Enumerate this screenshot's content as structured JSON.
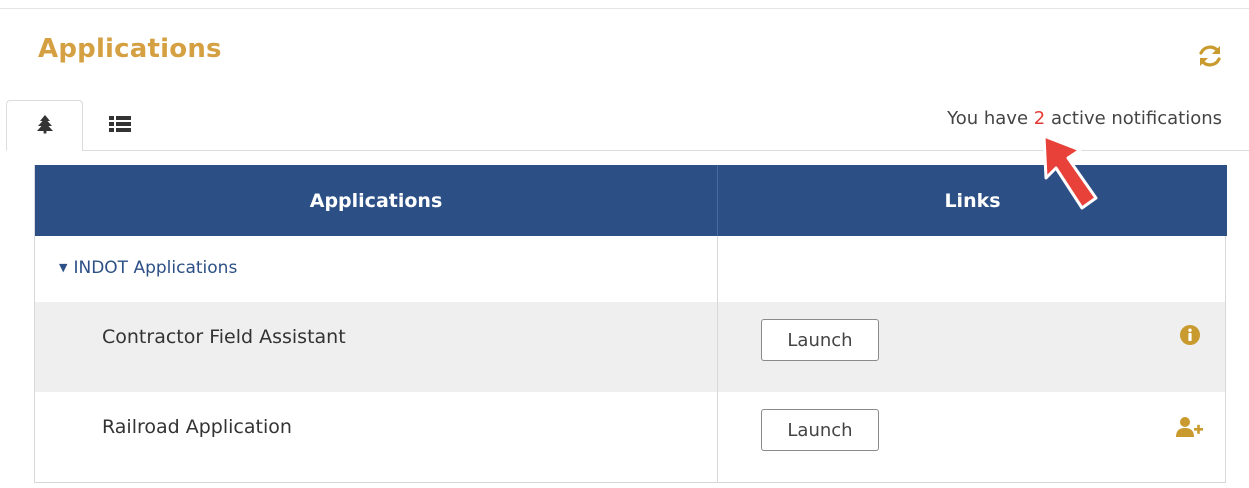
{
  "page": {
    "title": "Applications"
  },
  "icons": {
    "refresh": "refresh-icon",
    "tab_tree": "tree-icon",
    "tab_list": "list-icon",
    "info": "info-icon",
    "add_user": "user-plus-icon"
  },
  "colors": {
    "title": "#d4a041",
    "header_bg": "#2c5086",
    "count": "#e53935",
    "arrow": "#e8413a",
    "icon_gold": "#c99a2e"
  },
  "notifications": {
    "prefix": "You have",
    "count": "2",
    "suffix": "active notifications"
  },
  "table": {
    "columns": [
      "Applications",
      "Links"
    ],
    "group": {
      "label": "INDOT Applications",
      "expanded": true
    },
    "rows": [
      {
        "name": "Contractor Field Assistant",
        "button": "Launch",
        "icon": "info-icon"
      },
      {
        "name": "Railroad Application",
        "button": "Launch",
        "icon": "user-plus-icon"
      }
    ]
  }
}
